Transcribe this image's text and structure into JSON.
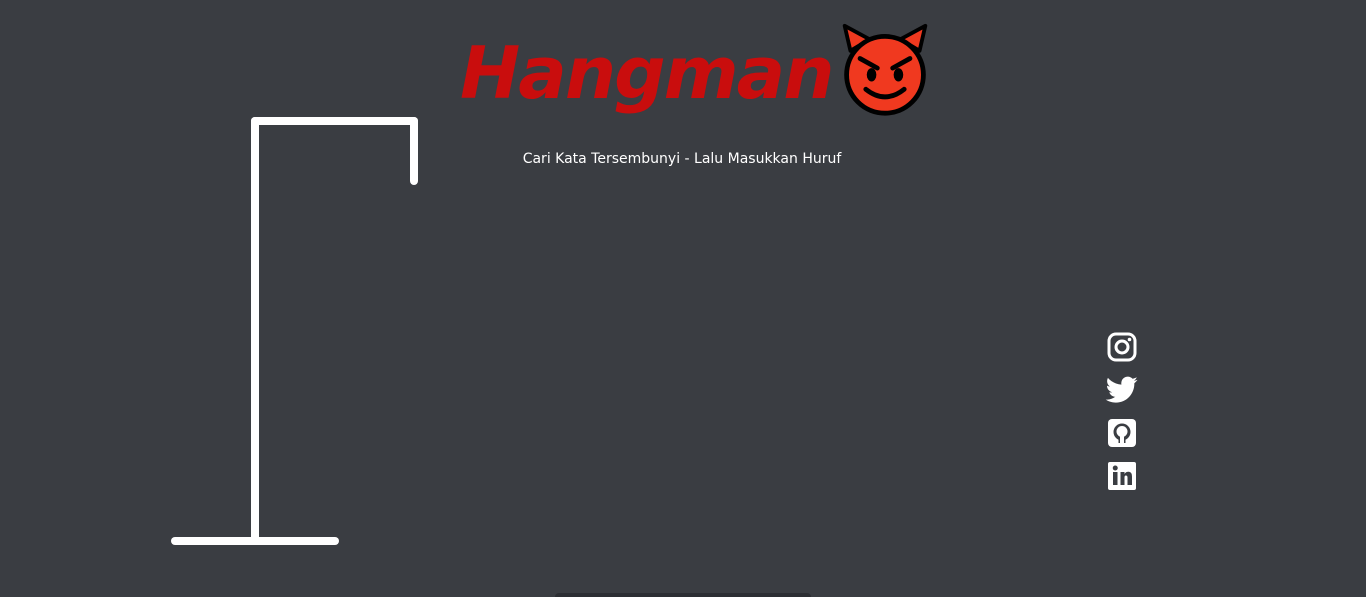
{
  "game": {
    "title": "Hangman",
    "title_emoji": "smiling-devil-icon",
    "subtitle": "Cari Kata Tersembunyi - Lalu Masukkan Huruf",
    "title_color": "#c90d0d",
    "background_color": "#3a3d42",
    "gallows_color": "#ffffff"
  },
  "social": {
    "items": [
      {
        "name": "instagram-icon"
      },
      {
        "name": "twitter-icon"
      },
      {
        "name": "github-icon"
      },
      {
        "name": "linkedin-icon"
      }
    ]
  }
}
